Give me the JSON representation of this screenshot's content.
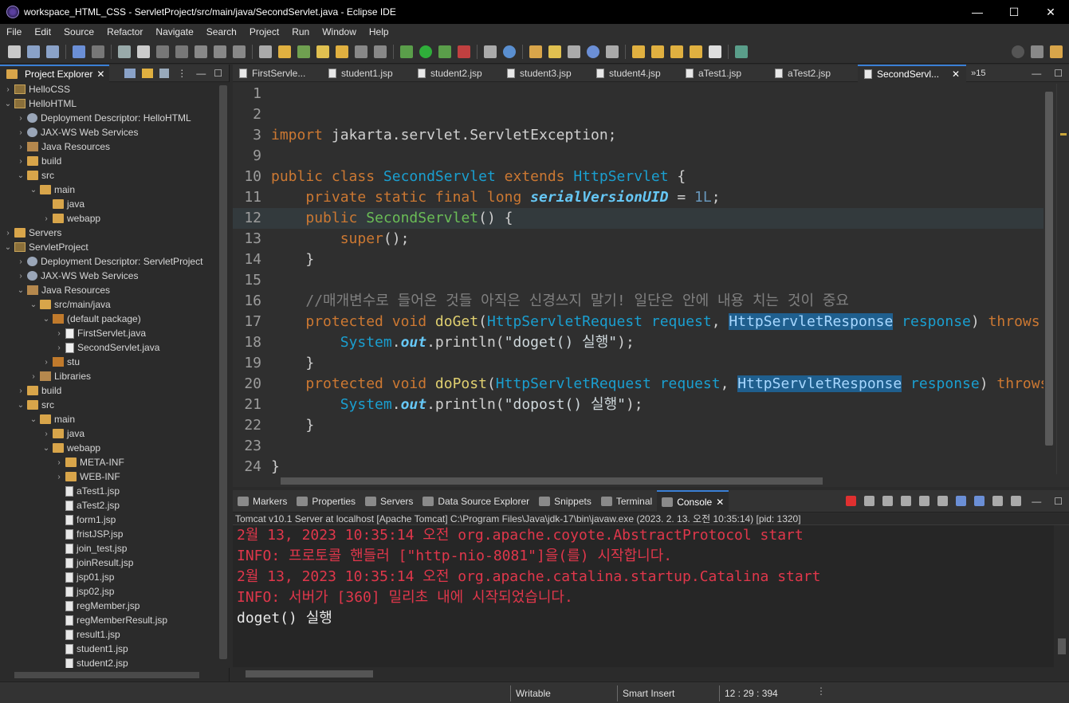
{
  "window": {
    "title": "workspace_HTML_CSS - ServletProject/src/main/java/SecondServlet.java - Eclipse IDE",
    "minimize": "—",
    "maximize": "☐",
    "close": "✕"
  },
  "menu": [
    "File",
    "Edit",
    "Source",
    "Refactor",
    "Navigate",
    "Search",
    "Project",
    "Run",
    "Window",
    "Help"
  ],
  "explorer": {
    "tab_label": "Project Explorer",
    "tree": [
      {
        "label": "HelloCSS",
        "depth": 0,
        "chev": "›",
        "icon": "project"
      },
      {
        "label": "HelloHTML",
        "depth": 0,
        "chev": "⌄",
        "icon": "project"
      },
      {
        "label": "Deployment Descriptor: HelloHTML",
        "depth": 1,
        "chev": "›",
        "icon": "dd"
      },
      {
        "label": "JAX-WS Web Services",
        "depth": 1,
        "chev": "›",
        "icon": "dd"
      },
      {
        "label": "Java Resources",
        "depth": 1,
        "chev": "›",
        "icon": "lib"
      },
      {
        "label": "build",
        "depth": 1,
        "chev": "›",
        "icon": "folder"
      },
      {
        "label": "src",
        "depth": 1,
        "chev": "⌄",
        "icon": "folder"
      },
      {
        "label": "main",
        "depth": 2,
        "chev": "⌄",
        "icon": "folder"
      },
      {
        "label": "java",
        "depth": 3,
        "chev": "",
        "icon": "folder"
      },
      {
        "label": "webapp",
        "depth": 3,
        "chev": "›",
        "icon": "folder"
      },
      {
        "label": "Servers",
        "depth": 0,
        "chev": "›",
        "icon": "folder"
      },
      {
        "label": "ServletProject",
        "depth": 0,
        "chev": "⌄",
        "icon": "project"
      },
      {
        "label": "Deployment Descriptor: ServletProject",
        "depth": 1,
        "chev": "›",
        "icon": "dd"
      },
      {
        "label": "JAX-WS Web Services",
        "depth": 1,
        "chev": "›",
        "icon": "dd"
      },
      {
        "label": "Java Resources",
        "depth": 1,
        "chev": "⌄",
        "icon": "lib"
      },
      {
        "label": "src/main/java",
        "depth": 2,
        "chev": "⌄",
        "icon": "folder"
      },
      {
        "label": "(default package)",
        "depth": 3,
        "chev": "⌄",
        "icon": "pkg"
      },
      {
        "label": "FirstServlet.java",
        "depth": 4,
        "chev": "›",
        "icon": "java"
      },
      {
        "label": "SecondServlet.java",
        "depth": 4,
        "chev": "›",
        "icon": "java"
      },
      {
        "label": "stu",
        "depth": 3,
        "chev": "›",
        "icon": "pkg"
      },
      {
        "label": "Libraries",
        "depth": 2,
        "chev": "›",
        "icon": "lib"
      },
      {
        "label": "build",
        "depth": 1,
        "chev": "›",
        "icon": "folder"
      },
      {
        "label": "src",
        "depth": 1,
        "chev": "⌄",
        "icon": "folder"
      },
      {
        "label": "main",
        "depth": 2,
        "chev": "⌄",
        "icon": "folder"
      },
      {
        "label": "java",
        "depth": 3,
        "chev": "›",
        "icon": "folder"
      },
      {
        "label": "webapp",
        "depth": 3,
        "chev": "⌄",
        "icon": "folder"
      },
      {
        "label": "META-INF",
        "depth": 4,
        "chev": "›",
        "icon": "folder"
      },
      {
        "label": "WEB-INF",
        "depth": 4,
        "chev": "›",
        "icon": "folder"
      },
      {
        "label": "aTest1.jsp",
        "depth": 4,
        "chev": "",
        "icon": "jsp"
      },
      {
        "label": "aTest2.jsp",
        "depth": 4,
        "chev": "",
        "icon": "jsp"
      },
      {
        "label": "form1.jsp",
        "depth": 4,
        "chev": "",
        "icon": "jsp"
      },
      {
        "label": "fristJSP.jsp",
        "depth": 4,
        "chev": "",
        "icon": "jsp"
      },
      {
        "label": "join_test.jsp",
        "depth": 4,
        "chev": "",
        "icon": "jsp"
      },
      {
        "label": "joinResult.jsp",
        "depth": 4,
        "chev": "",
        "icon": "jsp"
      },
      {
        "label": "jsp01.jsp",
        "depth": 4,
        "chev": "",
        "icon": "jsp"
      },
      {
        "label": "jsp02.jsp",
        "depth": 4,
        "chev": "",
        "icon": "jsp"
      },
      {
        "label": "regMember.jsp",
        "depth": 4,
        "chev": "",
        "icon": "jsp"
      },
      {
        "label": "regMemberResult.jsp",
        "depth": 4,
        "chev": "",
        "icon": "jsp"
      },
      {
        "label": "result1.jsp",
        "depth": 4,
        "chev": "",
        "icon": "jsp"
      },
      {
        "label": "student1.jsp",
        "depth": 4,
        "chev": "",
        "icon": "jsp"
      },
      {
        "label": "student2.jsp",
        "depth": 4,
        "chev": "",
        "icon": "jsp"
      }
    ]
  },
  "editor": {
    "tabs": [
      {
        "label": "FirstServle...",
        "active": false
      },
      {
        "label": "student1.jsp",
        "active": false
      },
      {
        "label": "student2.jsp",
        "active": false
      },
      {
        "label": "student3.jsp",
        "active": false
      },
      {
        "label": "student4.jsp",
        "active": false
      },
      {
        "label": "aTest1.jsp",
        "active": false
      },
      {
        "label": "aTest2.jsp",
        "active": false
      },
      {
        "label": "SecondServl...",
        "active": true
      }
    ],
    "overflow_label": "»15",
    "lines": [
      {
        "n": "1",
        "parts": []
      },
      {
        "n": "2",
        "parts": []
      },
      {
        "n": "3",
        "parts": [
          [
            "kw",
            "import"
          ],
          [
            "",
            " jakarta.servlet.ServletException;"
          ]
        ]
      },
      {
        "n": "9",
        "parts": []
      },
      {
        "n": "10",
        "parts": [
          [
            "kw",
            "public"
          ],
          [
            "",
            " "
          ],
          [
            "kw",
            "class"
          ],
          [
            "",
            " "
          ],
          [
            "cls",
            "SecondServlet"
          ],
          [
            "",
            " "
          ],
          [
            "kw",
            "extends"
          ],
          [
            "",
            " "
          ],
          [
            "cls",
            "HttpServlet"
          ],
          [
            "",
            " {"
          ]
        ]
      },
      {
        "n": "11",
        "parts": [
          [
            "",
            "    "
          ],
          [
            "kw",
            "private static final long"
          ],
          [
            "",
            " "
          ],
          [
            "fld",
            "serialVersionUID"
          ],
          [
            "",
            " = "
          ],
          [
            "num",
            "1L"
          ],
          [
            "",
            ";"
          ]
        ]
      },
      {
        "n": "12",
        "parts": [
          [
            "",
            "    "
          ],
          [
            "kw",
            "public"
          ],
          [
            "",
            " "
          ],
          [
            "meth-green",
            "SecondServlet"
          ],
          [
            "",
            "() {"
          ]
        ],
        "hl": true
      },
      {
        "n": "13",
        "parts": [
          [
            "",
            "        "
          ],
          [
            "kw",
            "super"
          ],
          [
            "",
            "();"
          ]
        ]
      },
      {
        "n": "14",
        "parts": [
          [
            "",
            "    }"
          ]
        ]
      },
      {
        "n": "15",
        "parts": []
      },
      {
        "n": "16",
        "parts": [
          [
            "",
            "    "
          ],
          [
            "cm",
            "//매개변수로 들어온 것들 아직은 신경쓰지 말기! 일단은 안에 내용 치는 것이 중요"
          ]
        ]
      },
      {
        "n": "17",
        "parts": [
          [
            "",
            "    "
          ],
          [
            "kw",
            "protected void"
          ],
          [
            "",
            " "
          ],
          [
            "fn",
            "doGet"
          ],
          [
            "",
            "("
          ],
          [
            "cls",
            "HttpServletRequest"
          ],
          [
            "",
            " "
          ],
          [
            "ty",
            "request"
          ],
          [
            "",
            ", "
          ],
          [
            "sel",
            "HttpServletResponse"
          ],
          [
            "",
            " "
          ],
          [
            "ty",
            "response"
          ],
          [
            "",
            ") "
          ],
          [
            "kw",
            "throws"
          ]
        ]
      },
      {
        "n": "18",
        "parts": [
          [
            "",
            "        "
          ],
          [
            "cls",
            "System"
          ],
          [
            "",
            "."
          ],
          [
            "fld",
            "out"
          ],
          [
            "",
            ".println("
          ],
          [
            "str",
            "\"doget() 실행\""
          ],
          [
            "",
            ");"
          ]
        ]
      },
      {
        "n": "19",
        "parts": [
          [
            "",
            "    }"
          ]
        ]
      },
      {
        "n": "20",
        "parts": [
          [
            "",
            "    "
          ],
          [
            "kw",
            "protected void"
          ],
          [
            "",
            " "
          ],
          [
            "fn",
            "doPost"
          ],
          [
            "",
            "("
          ],
          [
            "cls",
            "HttpServletRequest"
          ],
          [
            "",
            " "
          ],
          [
            "ty",
            "request"
          ],
          [
            "",
            ", "
          ],
          [
            "sel",
            "HttpServletResponse"
          ],
          [
            "",
            " "
          ],
          [
            "ty",
            "response"
          ],
          [
            "",
            ") "
          ],
          [
            "kw",
            "throws"
          ]
        ]
      },
      {
        "n": "21",
        "parts": [
          [
            "",
            "        "
          ],
          [
            "cls",
            "System"
          ],
          [
            "",
            "."
          ],
          [
            "fld",
            "out"
          ],
          [
            "",
            ".println("
          ],
          [
            "str",
            "\"dopost() 실행\""
          ],
          [
            "",
            ");"
          ]
        ]
      },
      {
        "n": "22",
        "parts": [
          [
            "",
            "    }"
          ]
        ]
      },
      {
        "n": "23",
        "parts": []
      },
      {
        "n": "24",
        "parts": [
          [
            "",
            "}"
          ]
        ]
      }
    ]
  },
  "bottom": {
    "tabs": [
      {
        "label": "Markers",
        "active": false
      },
      {
        "label": "Properties",
        "active": false
      },
      {
        "label": "Servers",
        "active": false
      },
      {
        "label": "Data Source Explorer",
        "active": false
      },
      {
        "label": "Snippets",
        "active": false
      },
      {
        "label": "Terminal",
        "active": false
      },
      {
        "label": "Console",
        "active": true
      }
    ],
    "console_header": "Tomcat v10.1 Server at localhost [Apache Tomcat] C:\\Program Files\\Java\\jdk-17\\bin\\javaw.exe  (2023. 2. 13. 오전 10:35:14) [pid: 1320]",
    "console_lines": [
      {
        "kind": "err",
        "text": "2월 13, 2023 10:35:14 오전 org.apache.coyote.AbstractProtocol start"
      },
      {
        "kind": "err",
        "text": "INFO: 프로토콜 핸들러 [\"http-nio-8081\"]을(를) 시작합니다."
      },
      {
        "kind": "err",
        "text": "2월 13, 2023 10:35:14 오전 org.apache.catalina.startup.Catalina start"
      },
      {
        "kind": "err",
        "text": "INFO: 서버가 [360] 밀리초 내에 시작되었습니다."
      },
      {
        "kind": "out",
        "text": "doget() 실행"
      }
    ]
  },
  "status": {
    "writable": "Writable",
    "insert_mode": "Smart Insert",
    "position": "12 : 29 : 394"
  },
  "colors": {
    "accent_tab": "#3a7fd5",
    "console_error": "#e0374b",
    "keyword": "#cc7832",
    "selection": "#1f5f8e"
  }
}
